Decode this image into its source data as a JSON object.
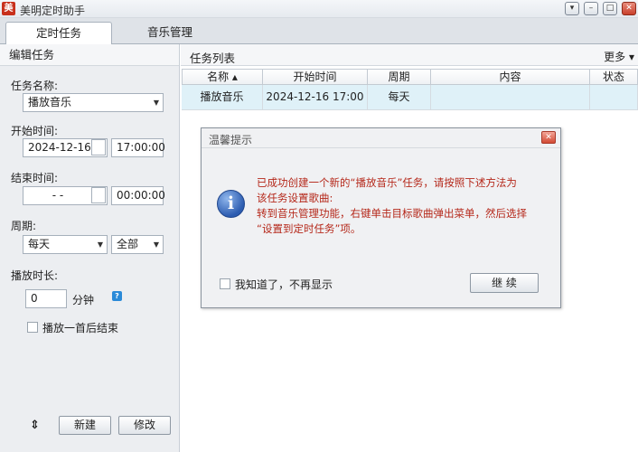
{
  "window": {
    "app_icon": "美",
    "title": "美明定时助手",
    "controls": [
      "▾",
      "–",
      "□",
      "✕"
    ]
  },
  "tabs": [
    {
      "label": "定时任务",
      "active": true
    },
    {
      "label": "音乐管理",
      "active": false
    }
  ],
  "edit_panel": {
    "title": "编辑任务",
    "task_name_label": "任务名称:",
    "task_name_value": "播放音乐",
    "start_label": "开始时间:",
    "start_date": "2024-12-16",
    "start_time": "17:00:00",
    "end_label": "结束时间:",
    "end_date": "-   -",
    "end_time": "00:00:00",
    "cycle_label": "周期:",
    "cycle_value": "每天",
    "cycle_scope": "全部",
    "duration_label": "播放时长:",
    "duration_value": "0",
    "duration_unit": "分钟",
    "help_glyph": "?",
    "stop_after_one_label": "播放一首后结束",
    "refresh_glyph": "⇕",
    "new_button": "新建",
    "edit_button": "修改"
  },
  "task_list": {
    "title": "任务列表",
    "more_label": "更多 ▾",
    "columns": [
      "名称 ▴",
      "开始时间",
      "周期",
      "内容",
      "状态"
    ],
    "rows": [
      {
        "name": "播放音乐",
        "start": "2024-12-16 17:00",
        "cycle": "每天",
        "content": "",
        "status": ""
      }
    ]
  },
  "dialog": {
    "title": "温馨提示",
    "close_glyph": "✕",
    "info_glyph": "i",
    "message_lines": [
      "已成功创建一个新的“播放音乐”任务，请按照下述方法为",
      "该任务设置歌曲:",
      "转到音乐管理功能，右键单击目标歌曲弹出菜单，然后选择",
      "“设置到定时任务”项。"
    ],
    "dont_show_label": "我知道了，不再显示",
    "continue_button": "继 续"
  },
  "colors": {
    "message_text": "#b5281a",
    "selected_row": "#dff1f8",
    "panel_bg": "#eceef1"
  }
}
